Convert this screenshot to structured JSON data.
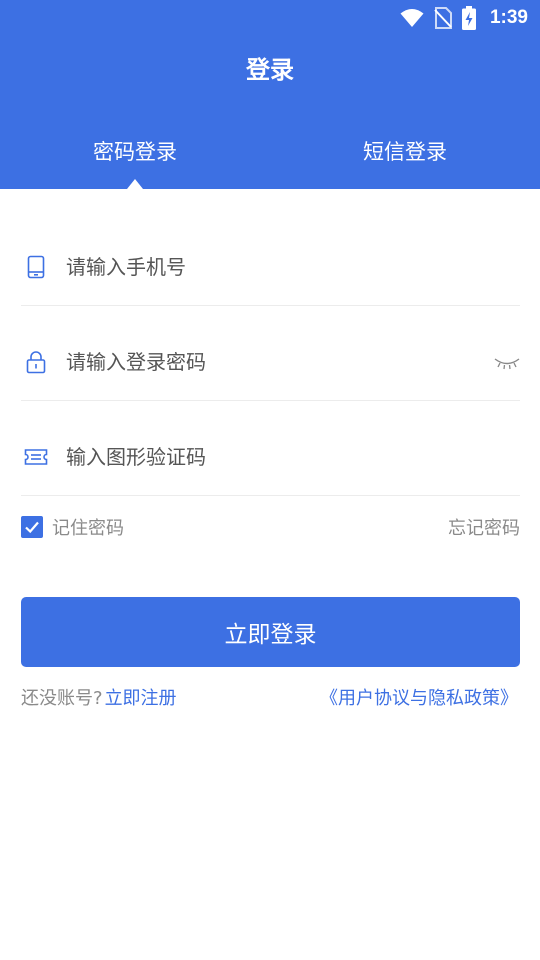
{
  "status_bar": {
    "time": "1:39",
    "icons": [
      "wifi-icon",
      "no-sim-icon",
      "battery-charging-icon"
    ]
  },
  "header": {
    "title": "登录",
    "tabs": [
      {
        "label": "密码登录",
        "active": true
      },
      {
        "label": "短信登录",
        "active": false
      }
    ]
  },
  "form": {
    "phone": {
      "icon": "phone-icon",
      "placeholder": "请输入手机号",
      "value": ""
    },
    "password": {
      "icon": "lock-icon",
      "placeholder": "请输入登录密码",
      "value": "",
      "toggle_icon": "eye-closed-icon"
    },
    "captcha": {
      "icon": "ticket-icon",
      "placeholder": "输入图形验证码",
      "value": ""
    },
    "remember_label": "记住密码",
    "remember_checked": true,
    "forgot_label": "忘记密码",
    "submit_label": "立即登录"
  },
  "footer": {
    "no_account_label": "还没账号?",
    "register_label": "立即注册",
    "agreement_label": "《用户协议与隐私政策》"
  },
  "colors": {
    "primary": "#3d70e3",
    "muted_text": "#8a8a8a",
    "divider": "#ececec"
  }
}
